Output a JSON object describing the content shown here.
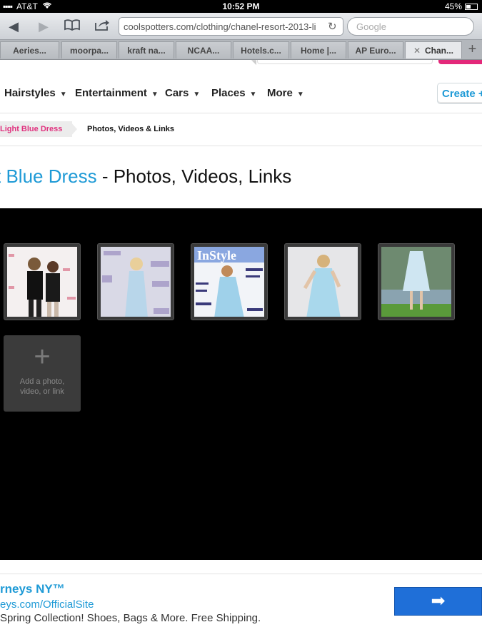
{
  "status": {
    "carrier": "AT&T",
    "time": "10:52 PM",
    "battery": "45%",
    "battery_level": 0.45
  },
  "toolbar": {
    "url": "coolspotters.com/clothing/chanel-resort-2013-li",
    "search_placeholder": "Google"
  },
  "tabs": [
    {
      "label": "Aeries..."
    },
    {
      "label": "moorpa..."
    },
    {
      "label": "kraft na..."
    },
    {
      "label": "NCAA..."
    },
    {
      "label": "Hotels.c..."
    },
    {
      "label": "Home |..."
    },
    {
      "label": "AP Euro..."
    },
    {
      "label": "Chan...",
      "active": true
    }
  ],
  "nav": {
    "items": [
      {
        "label": "Hairstyles"
      },
      {
        "label": "Entertainment"
      },
      {
        "label": "Cars"
      },
      {
        "label": "Places"
      },
      {
        "label": "More"
      }
    ],
    "create_label": "Create +"
  },
  "breadcrumb": {
    "parent": "Light Blue Dress",
    "current": "Photos, Videos & Links"
  },
  "title": {
    "accent": "t Blue Dress",
    "rest": " - Photos, Videos, Links"
  },
  "gallery": {
    "add_label": "Add a photo, video, or link"
  },
  "ad": {
    "headline": "rneys NY™",
    "url": "eys.com/OfficialSite",
    "description": "Spring Collection! Shoes, Bags & More. Free Shipping."
  }
}
